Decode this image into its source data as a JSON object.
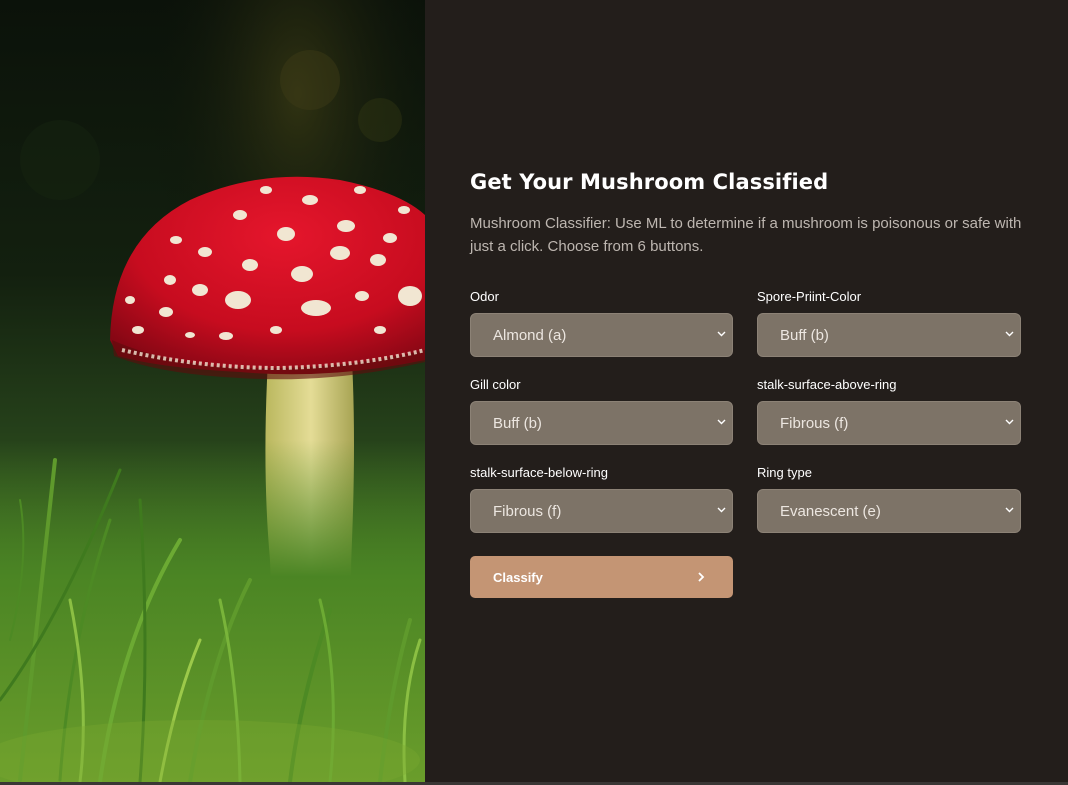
{
  "form": {
    "title": "Get Your Mushroom Classified",
    "description": "Mushroom Classifier: Use ML to determine if a mushroom is poisonous or safe with just a click. Choose from 6 buttons.",
    "fields": [
      {
        "label": "Odor",
        "value": "Almond (a)"
      },
      {
        "label": "Spore-Priint-Color",
        "value": "Buff (b)"
      },
      {
        "label": "Gill color",
        "value": "Buff (b)"
      },
      {
        "label": "stalk-surface-above-ring",
        "value": "Fibrous (f)"
      },
      {
        "label": "stalk-surface-below-ring",
        "value": "Fibrous (f)"
      },
      {
        "label": "Ring type",
        "value": "Evanescent (e)"
      }
    ],
    "submit_label": "Classify"
  },
  "image": {
    "subject": "red fly agaric mushroom with white spots in green grass"
  },
  "colors": {
    "panel_background": "#231e1b",
    "select_background": "#7d7367",
    "button_background": "#c49574"
  },
  "icons": {
    "select_chevron": "chevron-down-icon",
    "button_arrow": "chevron-right-icon"
  }
}
